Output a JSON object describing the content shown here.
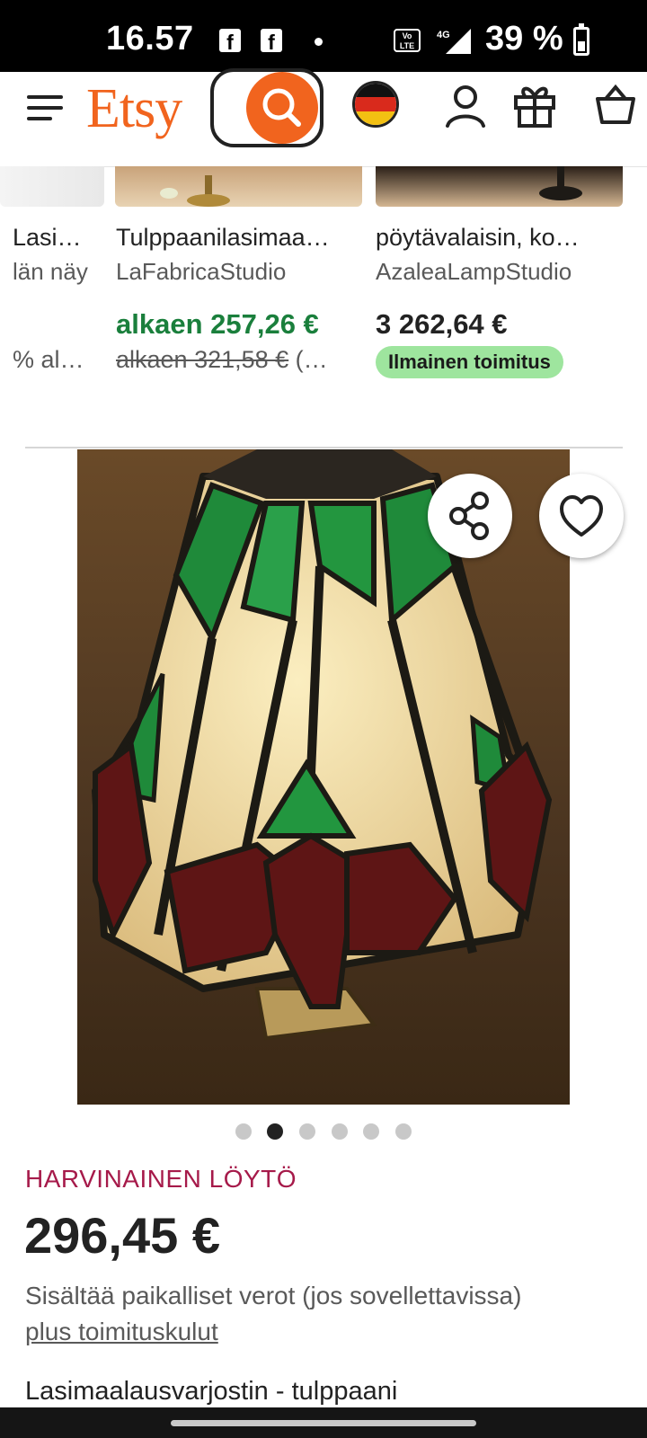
{
  "status_bar": {
    "time": "16.57",
    "notif_1": "f",
    "notif_2": "f",
    "volte": "Vo LTE",
    "network": "4G",
    "battery": "39 %"
  },
  "header": {
    "logo": "Etsy",
    "icons": [
      "menu-icon",
      "search-icon",
      "germany-flag-icon",
      "user-icon",
      "gift-icon",
      "basket-icon"
    ]
  },
  "recommendations": [
    {
      "title": "Lasi…",
      "shop": "län näy",
      "price": "",
      "original": "% al…"
    },
    {
      "title": "Tulppaanilasimaa…",
      "shop": "LaFabricaStudio",
      "price": "alkaen 257,26 €",
      "original": "alkaen 321,58 €",
      "original_suffix": " (…"
    },
    {
      "title": "pöytävalaisin, ko…",
      "shop": "AzaleaLampStudio",
      "price": "3 262,64 €",
      "badge": "Ilmainen toimitus"
    }
  ],
  "colors": {
    "brand": "#f1641e",
    "sale_green": "#1a7f3c",
    "rare": "#a61a4a",
    "badge": "#9ee59e"
  },
  "gallery": {
    "image_count": 6,
    "active_index": 1
  },
  "product": {
    "rare_label": "HARVINAINEN LÖYTÖ",
    "price": "296,45 €",
    "tax_note": "Sisältää paikalliset verot (jos sovellettavissa)",
    "shipping_link": "plus toimituskulut",
    "title": "Lasimaalausvarjostin - tulppaani"
  }
}
